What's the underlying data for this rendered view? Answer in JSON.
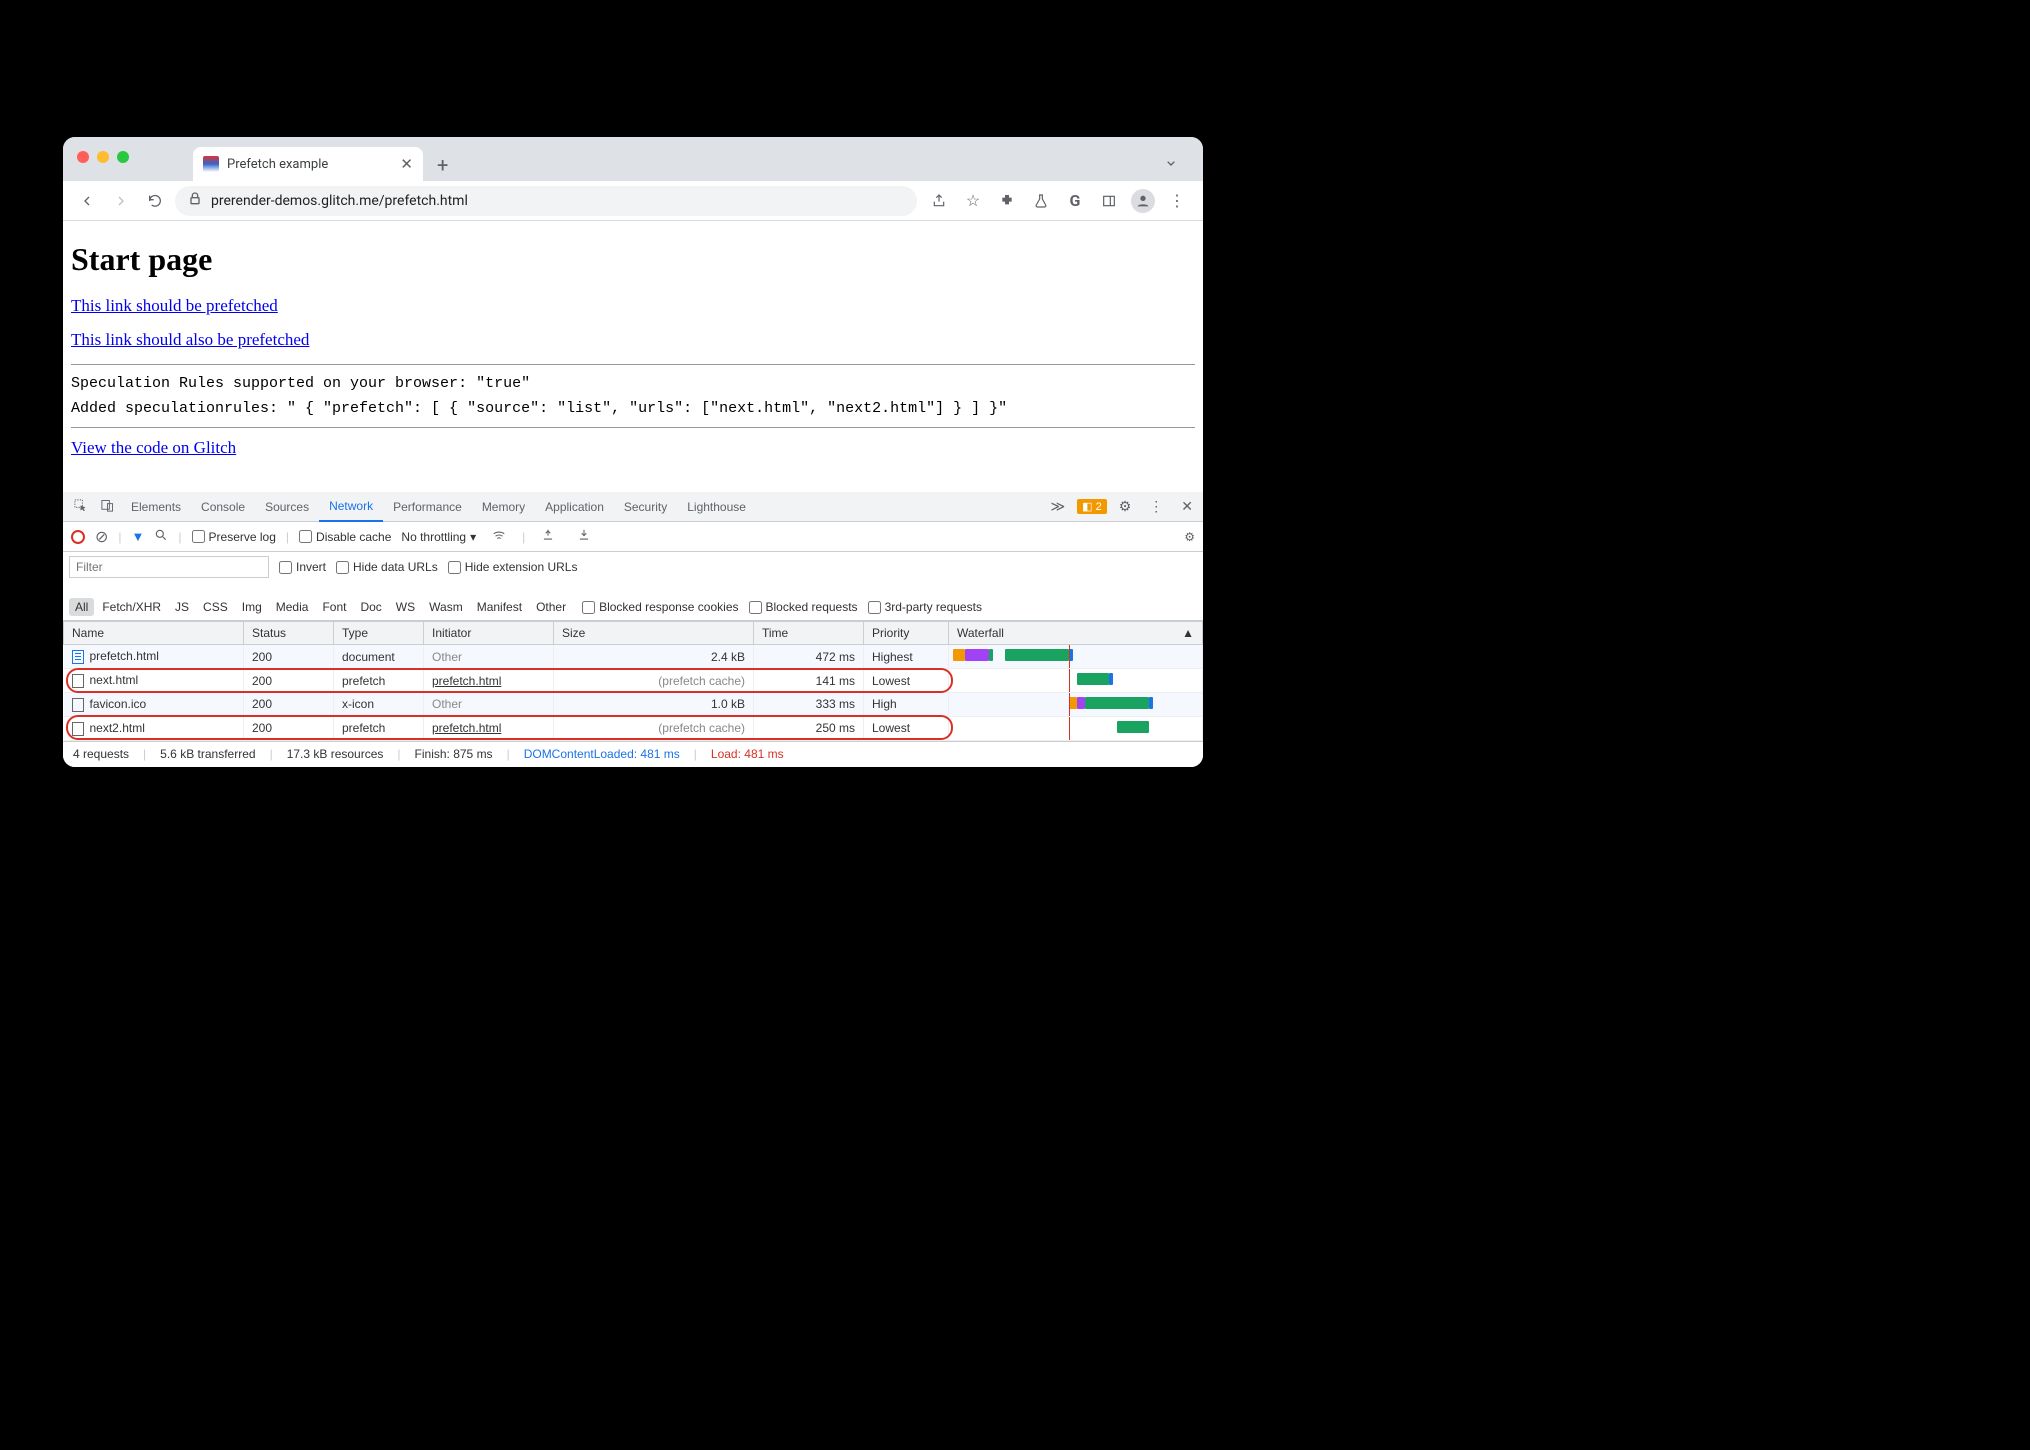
{
  "tab": {
    "title": "Prefetch example"
  },
  "url": "prerender-demos.glitch.me/prefetch.html",
  "page": {
    "heading": "Start page",
    "link1": "This link should be prefetched",
    "link2": "This link should also be prefetched",
    "code1": "Speculation Rules supported on your browser: \"true\"",
    "code2": "Added speculationrules: \" { \"prefetch\": [ { \"source\": \"list\", \"urls\": [\"next.html\", \"next2.html\"] } ] }\"",
    "link3": "View the code on Glitch"
  },
  "devtools": {
    "tabs": [
      "Elements",
      "Console",
      "Sources",
      "Network",
      "Performance",
      "Memory",
      "Application",
      "Security",
      "Lighthouse"
    ],
    "warnings": "2",
    "controls": {
      "preserve_log": "Preserve log",
      "disable_cache": "Disable cache",
      "throttling": "No throttling"
    },
    "filter": {
      "placeholder": "Filter",
      "invert": "Invert",
      "hide_data": "Hide data URLs",
      "hide_ext": "Hide extension URLs",
      "types": [
        "All",
        "Fetch/XHR",
        "JS",
        "CSS",
        "Img",
        "Media",
        "Font",
        "Doc",
        "WS",
        "Wasm",
        "Manifest",
        "Other"
      ],
      "blocked_cookies": "Blocked response cookies",
      "blocked_req": "Blocked requests",
      "third_party": "3rd-party requests"
    },
    "columns": [
      "Name",
      "Status",
      "Type",
      "Initiator",
      "Size",
      "Time",
      "Priority",
      "Waterfall"
    ],
    "rows": [
      {
        "name": "prefetch.html",
        "status": "200",
        "type": "document",
        "initiator": "Other",
        "initiator_muted": true,
        "size": "2.4 kB",
        "time": "472 ms",
        "priority": "Highest",
        "icon": "doc",
        "highlight": false,
        "wf": [
          {
            "l": 1,
            "w": 3,
            "c": "#f29900"
          },
          {
            "l": 4,
            "w": 6,
            "c": "#a142f4"
          },
          {
            "l": 10,
            "w": 1,
            "c": "#1aa260"
          },
          {
            "l": 14,
            "w": 16,
            "c": "#1aa260"
          },
          {
            "l": 30,
            "w": 1,
            "c": "#1a73e8"
          }
        ]
      },
      {
        "name": "next.html",
        "status": "200",
        "type": "prefetch",
        "initiator": "prefetch.html",
        "initiator_muted": false,
        "size": "(prefetch cache)",
        "time": "141 ms",
        "priority": "Lowest",
        "icon": "blank",
        "highlight": true,
        "wf": [
          {
            "l": 32,
            "w": 8,
            "c": "#1aa260"
          },
          {
            "l": 40,
            "w": 1,
            "c": "#1a73e8"
          }
        ]
      },
      {
        "name": "favicon.ico",
        "status": "200",
        "type": "x-icon",
        "initiator": "Other",
        "initiator_muted": true,
        "size": "1.0 kB",
        "time": "333 ms",
        "priority": "High",
        "icon": "blank",
        "highlight": false,
        "wf": [
          {
            "l": 30,
            "w": 2,
            "c": "#f29900"
          },
          {
            "l": 32,
            "w": 2,
            "c": "#a142f4"
          },
          {
            "l": 34,
            "w": 16,
            "c": "#1aa260"
          },
          {
            "l": 50,
            "w": 1,
            "c": "#1a73e8"
          }
        ]
      },
      {
        "name": "next2.html",
        "status": "200",
        "type": "prefetch",
        "initiator": "prefetch.html",
        "initiator_muted": false,
        "size": "(prefetch cache)",
        "time": "250 ms",
        "priority": "Lowest",
        "icon": "blank",
        "highlight": true,
        "wf": [
          {
            "l": 42,
            "w": 8,
            "c": "#1aa260"
          }
        ]
      }
    ],
    "status_bar": {
      "requests": "4 requests",
      "transferred": "5.6 kB transferred",
      "resources": "17.3 kB resources",
      "finish": "Finish: 875 ms",
      "dcl": "DOMContentLoaded: 481 ms",
      "load": "Load: 481 ms"
    }
  }
}
